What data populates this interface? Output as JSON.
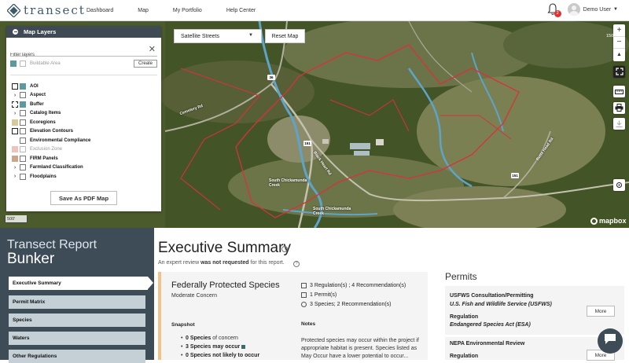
{
  "brand": {
    "name": "transect"
  },
  "nav": {
    "items": [
      "Dashboard",
      "Map",
      "My Portfolio",
      "Help Center"
    ]
  },
  "notifications": {
    "count": "2"
  },
  "user": {
    "name": "Demo User"
  },
  "map_layers_panel": {
    "title": "Map Layers",
    "filter_placeholder": "Filter layers",
    "buildable_area": "Buildable Area",
    "create_label": "Create",
    "layers": [
      {
        "label": "AOI",
        "checked": true
      },
      {
        "label": "Aspect"
      },
      {
        "label": "Buffer",
        "checked": true
      },
      {
        "label": "Catalog Items"
      },
      {
        "label": "Ecoregions"
      },
      {
        "label": "Elevation Contours"
      },
      {
        "label": "Environmental Compliance"
      },
      {
        "label": "Exclusion Zone",
        "disabled": true
      },
      {
        "label": "FIRM Panels"
      },
      {
        "label": "Farmland Classification"
      },
      {
        "label": "Floodplains"
      }
    ],
    "save_pdf_label": "Save As PDF Map"
  },
  "map": {
    "basemap": "Satellite Streets",
    "reset_label": "Reset Map",
    "scale_left": "500'",
    "scale_right": "150",
    "attribution": "mapbox",
    "labels": {
      "cemetery_road": "Cemetery Rd",
      "black_heart_rd": "Black Heart Rd",
      "butts_head_rd": "Butts Head Rd",
      "creek_label_1": "South Chickamunda Creek",
      "creek_label_2": "South Chickamunda Creek"
    },
    "shields": [
      "36",
      "151",
      "151"
    ]
  },
  "report": {
    "title": "Transect Report",
    "project": "Bunker",
    "nav": [
      "Executive Summary",
      "Permit Matrix",
      "Species",
      "Waters",
      "Other Regulations"
    ],
    "summary_title": "Executive Summary",
    "review_prefix": "An expert review",
    "review_status": "was not requested",
    "review_suffix": "for this report."
  },
  "species_card": {
    "title": "Federally Protected Species",
    "concern": "Moderate Concern",
    "snapshot_label": "Snapshot",
    "snapshot": [
      {
        "count": "0 Species",
        "rest": "of concern"
      },
      {
        "count": "3 Species",
        "rest": "may occur"
      },
      {
        "count": "0 Species",
        "rest": "not likely to occur"
      }
    ],
    "counts": [
      "3 Regulation(s) ; 4 Recommendation(s)",
      "1 Permit(s)",
      "3 Species; 2 Recommendation(s)"
    ],
    "notes_label": "Notes",
    "notes": "Protected species may occur within the project if appropriate habitat is present. Species listed as May Occur have a lower potential to occur..."
  },
  "permits": {
    "title": "Permits",
    "card1": {
      "name": "USFWS Consultation/Permitting",
      "agency": "U.S. Fish and Wildlife Service (USFWS)",
      "regulation_label": "Regulation",
      "regulation": "Endangered Species Act (ESA)",
      "more": "More"
    },
    "card2": {
      "name": "NEPA Environmental Review",
      "regulation_label": "Regulation",
      "more": "More"
    }
  }
}
